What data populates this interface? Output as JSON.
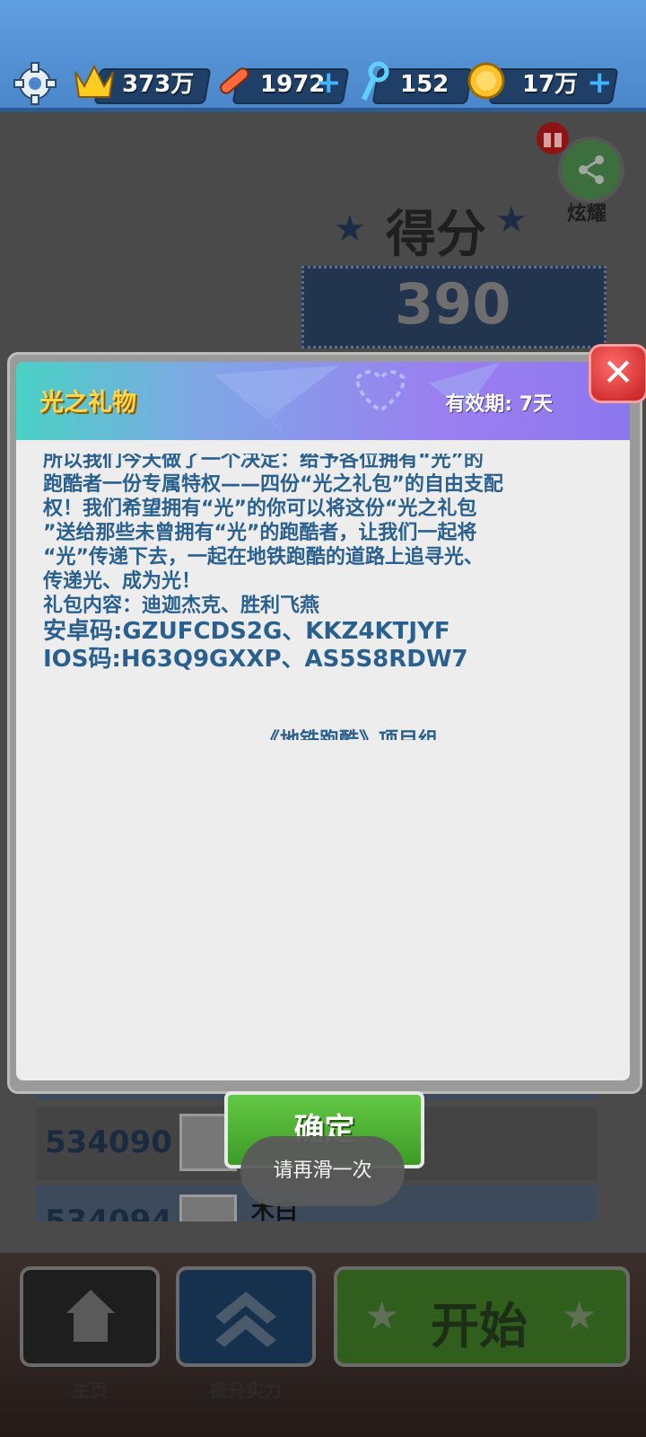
{
  "topbar": {
    "crowns": "373万",
    "hoverboards": "1972",
    "keys": "152",
    "coins": "17万",
    "plus_symbol": "+"
  },
  "score_panel": {
    "title": "得分",
    "score": "390",
    "share_label": "炫耀"
  },
  "leaderboard": {
    "rows": [
      {
        "score": "534090",
        "name": ""
      },
      {
        "score": "534094",
        "name": "木白"
      }
    ]
  },
  "modal": {
    "title": "光之礼物",
    "validity": "有效期: 7天",
    "body_lines": [
      "所以我们今天做了一个决定：给予各位拥有“光”的",
      "跑酷者一份专属特权——四份“光之礼包”的自由支配",
      "权！我们希望拥有“光”的你可以将这份“光之礼包",
      "”送给那些未曾拥有“光”的跑酷者，让我们一起将",
      "“光”传递下去，一起在地铁跑酷的道路上追寻光、",
      "传递光、成为光！",
      "礼包内容：迪迦杰克、胜利飞燕"
    ],
    "android_codes": "安卓码:GZUFCDS2G、KKZ4KTJYF",
    "ios_codes": "IOS码:H63Q9GXXP、AS5S8RDW7",
    "signature": "《地铁跑酷》项目组",
    "close_symbol": "✕",
    "confirm_label": "确定"
  },
  "toast": "请再滑一次",
  "bottom_nav": {
    "home_label": "主页",
    "upgrade_label": "提升实力",
    "start_label": "开始"
  }
}
